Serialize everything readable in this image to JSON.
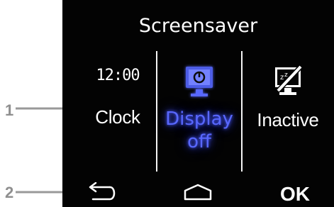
{
  "screen": {
    "title": "Screensaver"
  },
  "options": [
    {
      "id": "clock",
      "display_value": "12:00",
      "label": "Clock",
      "selected": false
    },
    {
      "id": "display_off",
      "label_lines": [
        "Display",
        "off"
      ],
      "selected": true,
      "icon": "power-monitor-icon",
      "selected_color": "#5968ff"
    },
    {
      "id": "inactive",
      "label": "Inactive",
      "selected": false,
      "icon": "monitor-sleep-icon"
    }
  ],
  "navigation": {
    "back_icon": "back-arrow-icon",
    "home_icon": "home-icon",
    "ok_label": "OK"
  },
  "callouts": [
    {
      "label": "1"
    },
    {
      "label": "2"
    }
  ],
  "colors": {
    "background": "#030303",
    "text": "#ffffff",
    "accent": "#5968ff",
    "callout": "#8f8f8f"
  }
}
